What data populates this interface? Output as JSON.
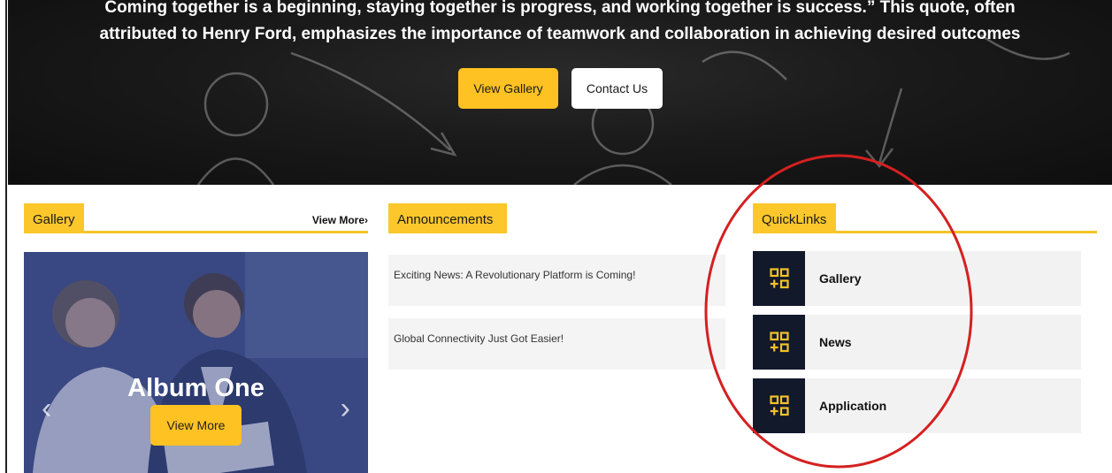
{
  "hero": {
    "quote": "Coming together is a beginning, staying together is progress, and working together is success.” This quote, often attributed to Henry Ford, emphasizes the importance of teamwork and collaboration in achieving desired outcomes",
    "gallery_button": "View Gallery",
    "contact_button": "Contact Us"
  },
  "gallery": {
    "title": "Gallery",
    "view_more": "View More",
    "album_title": "Album One",
    "album_button": "View More"
  },
  "announcements": {
    "title": "Announcements",
    "items": [
      "Exciting News: A Revolutionary Platform is Coming!",
      "Global Connectivity Just Got Easier!"
    ]
  },
  "quicklinks": {
    "title": "QuickLinks",
    "items": [
      {
        "label": "Gallery",
        "icon": "grid-plus-icon"
      },
      {
        "label": "News",
        "icon": "grid-plus-icon"
      },
      {
        "label": "Application",
        "icon": "grid-plus-icon"
      }
    ]
  },
  "colors": {
    "accent": "#ffc222",
    "icon_bg": "#12192b",
    "annotation": "#d42020"
  }
}
